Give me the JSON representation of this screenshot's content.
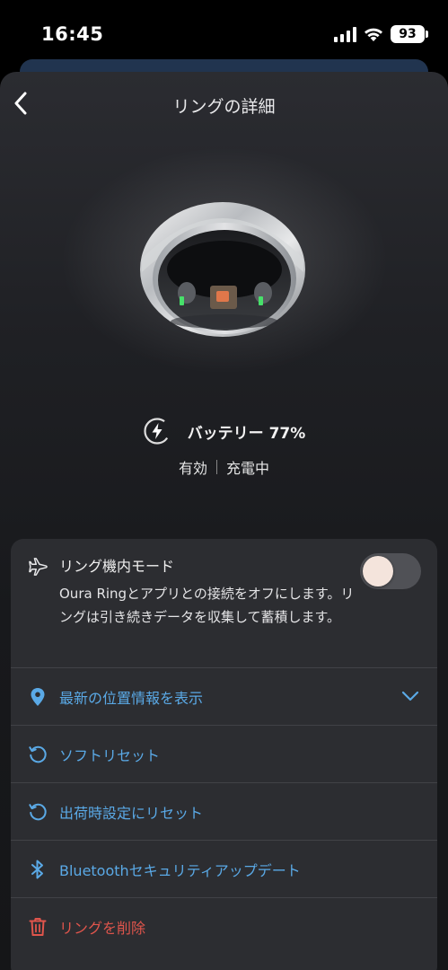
{
  "status_bar": {
    "time": "16:45",
    "battery": "93"
  },
  "header": {
    "title": "リングの詳細"
  },
  "battery": {
    "label": "バッテリー 77%",
    "level_percent": 77,
    "status_left": "有効",
    "status_right": "充電中"
  },
  "airplane_mode": {
    "title": "リング機内モード",
    "description": "Oura Ringとアプリとの接続をオフにします。リングは引き続きデータを収集して蓄積します。",
    "enabled": false
  },
  "actions": [
    {
      "label": "最新の位置情報を表示",
      "icon": "location-pin-icon"
    },
    {
      "label": "ソフトリセット",
      "icon": "reset-icon"
    },
    {
      "label": "出荷時設定にリセット",
      "icon": "reset-icon"
    },
    {
      "label": "Bluetoothセキュリティアップデート",
      "icon": "bluetooth-icon"
    },
    {
      "label": "リングを削除",
      "icon": "trash-icon"
    }
  ],
  "colors": {
    "accent": "#5aa9e6",
    "danger": "#e0554c",
    "card": "#2c2d31"
  }
}
